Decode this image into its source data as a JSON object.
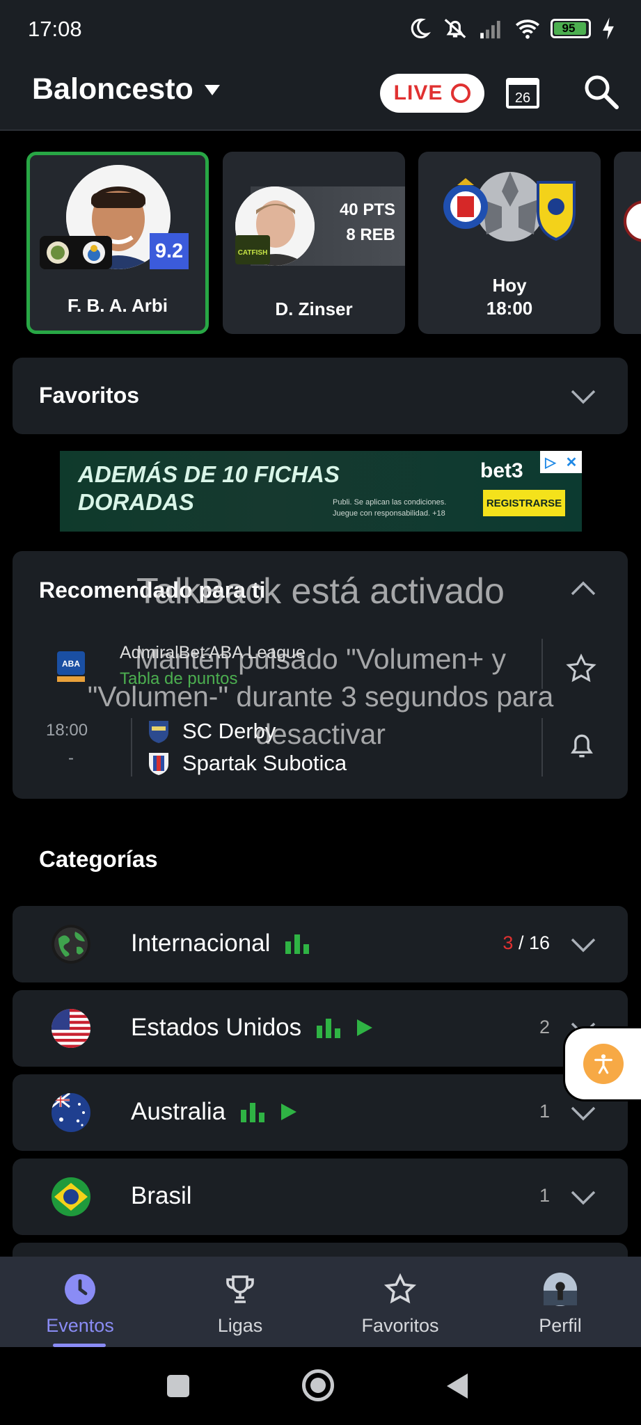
{
  "status_bar": {
    "time": "17:08",
    "battery": "95"
  },
  "header": {
    "sport": "Baloncesto",
    "live_label": "LIVE",
    "calendar_day": "26"
  },
  "featured": [
    {
      "name": "F. B. A. Arbi",
      "rating": "9.2"
    },
    {
      "name": "D. Zinser",
      "team_badge": "CATFISH",
      "stat1": "40 PTS",
      "stat2": "8 REB"
    },
    {
      "time1": "Hoy",
      "time2": "18:00"
    }
  ],
  "favorites": {
    "title": "Favoritos"
  },
  "ad": {
    "headline1": "ADEMÁS DE 10 FICHAS",
    "headline2": "DORADAS",
    "brand": "bet3",
    "cta": "REGISTRARSE",
    "fine1": "Publi. Se aplican las condiciones.",
    "fine2": "Juegue con responsabilidad. +18"
  },
  "recommended": {
    "title": "Recomendado para ti",
    "league": "AdmiralBet ABA League",
    "league_badge": "ABA",
    "league_sub": "Tabla de puntos",
    "match": {
      "time": "18:00",
      "status": "-",
      "home": "SC Derby",
      "away": "Spartak Subotica"
    }
  },
  "talkback": {
    "title": "TalkBack está activado",
    "line1": "Mantén pulsado \"Volumen+ y",
    "line2": "\"Volumen-\" durante 3 segundos para",
    "line3": "desactivar"
  },
  "categories": {
    "title": "Categorías",
    "items": [
      {
        "name": "Internacional",
        "live": "3",
        "sep": " / ",
        "total": "16"
      },
      {
        "name": "Estados Unidos",
        "total": "2"
      },
      {
        "name": "Australia",
        "total": "1"
      },
      {
        "name": "Brasil",
        "total": "1"
      }
    ]
  },
  "bottom_nav": [
    {
      "label": "Eventos",
      "icon": "clock-icon"
    },
    {
      "label": "Ligas",
      "icon": "trophy-icon"
    },
    {
      "label": "Favoritos",
      "icon": "star-icon"
    },
    {
      "label": "Perfil",
      "icon": "avatar"
    }
  ],
  "colors": {
    "accent": "#8a8cf5",
    "live": "#e03131",
    "green": "#28a745",
    "panel": "#1b1f24"
  }
}
